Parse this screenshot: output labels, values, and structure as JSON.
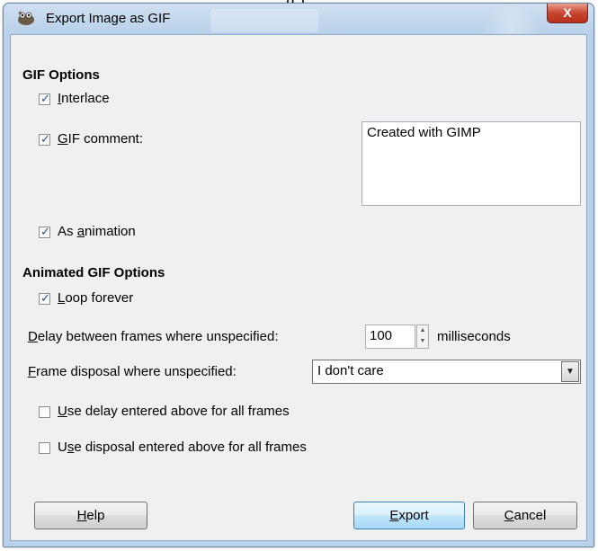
{
  "window": {
    "title": "Export Image as GIF",
    "close_label": "X"
  },
  "top_fragment": "(c)",
  "gif_options": {
    "heading": "GIF Options",
    "interlace": {
      "label_accel": "I",
      "label_rest": "nterlace",
      "checked": true
    },
    "gif_comment": {
      "label_accel": "G",
      "label_rest": "IF comment:",
      "checked": true,
      "value": "Created with GIMP"
    },
    "as_animation": {
      "label_pre": "As ",
      "label_accel": "a",
      "label_rest": "nimation",
      "checked": true
    }
  },
  "animated_options": {
    "heading": "Animated GIF Options",
    "loop_forever": {
      "label_accel": "L",
      "label_rest": "oop forever",
      "checked": true
    },
    "delay": {
      "label_accel": "D",
      "label_rest": "elay between frames where unspecified:",
      "value": "100",
      "unit": "milliseconds"
    },
    "disposal": {
      "label_accel": "F",
      "label_rest": "rame disposal where unspecified:",
      "selected": "I don't care"
    },
    "use_delay": {
      "label_accel": "U",
      "label_rest": "se delay entered above for all frames",
      "checked": false
    },
    "use_disposal": {
      "label_pre": "U",
      "label_accel": "s",
      "label_rest": "e disposal entered above for all frames",
      "checked": false
    }
  },
  "buttons": {
    "help": {
      "accel": "H",
      "rest": "elp"
    },
    "export": {
      "accel": "E",
      "rest": "xport"
    },
    "cancel": {
      "accel": "C",
      "rest": "ancel"
    }
  },
  "colors": {
    "title_gradient_top": "#cfe0f1",
    "title_gradient_bottom": "#b9d1ea",
    "client_bg": "#f0f0f0",
    "close_button": "#c9452f",
    "default_button_border": "#3c7fb1"
  },
  "icons": [
    "gimp-wilber-icon",
    "close-icon",
    "checkmark-icon",
    "spin-up-icon",
    "spin-down-icon",
    "dropdown-arrow-icon"
  ]
}
